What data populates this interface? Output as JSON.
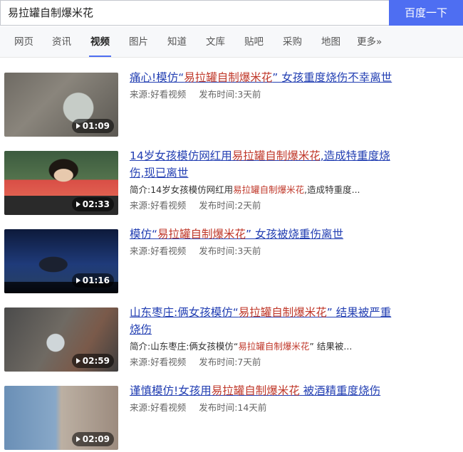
{
  "search": {
    "query": "易拉罐自制爆米花",
    "button_label": "百度一下"
  },
  "tabs": [
    {
      "label": "网页"
    },
    {
      "label": "资讯"
    },
    {
      "label": "视频"
    },
    {
      "label": "图片"
    },
    {
      "label": "知道"
    },
    {
      "label": "文库"
    },
    {
      "label": "贴吧"
    },
    {
      "label": "采购"
    },
    {
      "label": "地图"
    },
    {
      "label": "更多»"
    }
  ],
  "active_tab": "视频",
  "results": [
    {
      "title_pre": "痛心!模仿“",
      "title_hl": "易拉罐自制爆米花",
      "title_post": "” 女孩重度烧伤不幸离世",
      "summary_label": "",
      "source": "来源:好看视频",
      "time": "发布时间:3天前",
      "duration": "01:09"
    },
    {
      "title_pre": "14岁女孩模仿网红用",
      "title_hl": "易拉罐自制爆米花",
      "title_post": ",造成特重度烧伤,现已离世",
      "summary_pre": "简介:14岁女孩模仿网红用",
      "summary_hl": "易拉罐自制爆米花",
      "summary_post": ",造成特重度...",
      "source": "来源:好看视频",
      "time": "发布时间:2天前",
      "duration": "02:33"
    },
    {
      "title_pre": "模仿“",
      "title_hl": "易拉罐自制爆米花",
      "title_post": "” 女孩被烧重伤离世",
      "source": "来源:好看视频",
      "time": "发布时间:3天前",
      "duration": "01:16"
    },
    {
      "title_pre": "山东枣庄:俩女孩模仿“",
      "title_hl": "易拉罐自制爆米花",
      "title_post": "” 结果被严重烧伤",
      "summary_pre": "简介:山东枣庄:俩女孩模仿“",
      "summary_hl": "易拉罐自制爆米花",
      "summary_post": "” 结果被...",
      "source": "来源:好看视频",
      "time": "发布时间:7天前",
      "duration": "02:59"
    },
    {
      "title_pre": "谨慎模仿!女孩用",
      "title_hl": "易拉罐自制爆米花",
      "title_post": " 被酒精重度烧伤",
      "source": "来源:好看视频",
      "time": "发布时间:14天前",
      "duration": "02:09"
    }
  ],
  "colors": {
    "accent": "#4e6ef2",
    "link": "#2440b3",
    "highlight": "#c0392b"
  }
}
